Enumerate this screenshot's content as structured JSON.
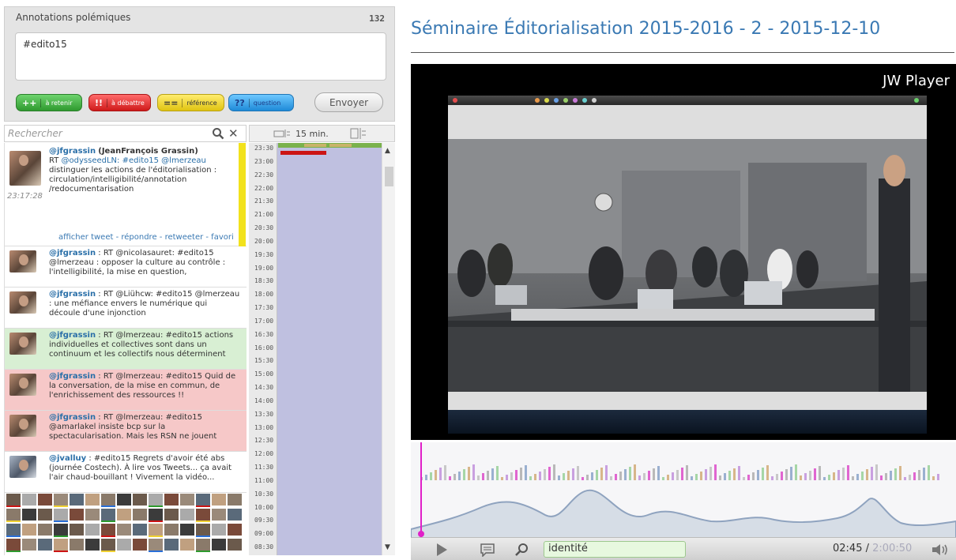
{
  "compose": {
    "title": "Annotations polémiques",
    "count": "132",
    "text": "#edito15",
    "buttons": [
      {
        "symbol": "++",
        "label": "à retenir",
        "color": "#3aaa3a"
      },
      {
        "symbol": "!!",
        "label": "à débattre",
        "color": "#e02b2b"
      },
      {
        "symbol": "==",
        "label": "référence",
        "color": "#f0d232"
      },
      {
        "symbol": "??",
        "label": "question",
        "color": "#2a9be6"
      }
    ],
    "send_label": "Envoyer"
  },
  "search": {
    "placeholder": "Rechercher",
    "zoom_label": "15 min."
  },
  "tweets": [
    {
      "user": "@jfgrassin",
      "realname": "(JeanFrançois Grassin)",
      "text_prefix": "RT ",
      "mention": "@odysseedLN: #edito15 @lmerzeau",
      "text": "distinguer les actions de l'éditorialisation : circulation/intelligibilité/annotation /redocumentarisation",
      "time": "23:17:28",
      "actions": "afficher tweet - répondre - retweeter - favori",
      "background": "#ffffff"
    },
    {
      "user": "@jfgrassin",
      "text": ": RT @nicolasauret: #edito15 @lmerzeau : opposer la culture au contrôle : l'intelligibilité, la mise en question,",
      "background": "#ffffff"
    },
    {
      "user": "@jfgrassin",
      "text": ": RT @Liühcw: #edito15 @lmerzeau : une méfiance envers le numérique qui découle d'une injonction",
      "background": "#ffffff"
    },
    {
      "user": "@jfgrassin",
      "text": ": RT @lmerzeau: #edito15 actions individuelles et collectives sont dans un continuum et les collectifs nous déterminent",
      "background": "#d8efd3"
    },
    {
      "user": "@jfgrassin",
      "text": ": RT @lmerzeau: #edito15 Quid de la conversation, de la mise en commun, de l'enrichissement des ressources !!",
      "background": "#f6c8c8"
    },
    {
      "user": "@jfgrassin",
      "text": ": RT @lmerzeau: #edito15 @amarlakel insiste bcp sur la spectacularisation. Mais les RSN ne jouent",
      "background": "#f6c8c8"
    },
    {
      "user": "@jvalluy",
      "text": ": #edito15 Regrets d'avoir été abs (journée Costech). À lire vos Tweets... ça avait l'air chaud-bouillant ! Vivement la vidéo...",
      "background": "#ffffff"
    }
  ],
  "timeline_labels": [
    "23:30",
    "23:00",
    "22:30",
    "22:00",
    "21:30",
    "21:00",
    "20:30",
    "20:00",
    "19:30",
    "19:00",
    "18:30",
    "18:00",
    "17:30",
    "17:00",
    "16:30",
    "16:00",
    "15:30",
    "15:00",
    "14:30",
    "14:00",
    "13:30",
    "13:00",
    "12:30",
    "12:00",
    "11:30",
    "11:00",
    "10:30",
    "10:00",
    "09:30",
    "09:00",
    "08:30"
  ],
  "video": {
    "title": "Séminaire Éditorialisation 2015-2016 - 2 - 2015-12-10",
    "player_label": "JW Player"
  },
  "controls": {
    "search_value": "identité",
    "current_time": "02:45",
    "separator": " / ",
    "total_time": "2:00:50"
  },
  "colors": {
    "accent": "#3a79b3",
    "timeline_bg": "#bfc0e0",
    "waveform": "#8fa3bf"
  }
}
